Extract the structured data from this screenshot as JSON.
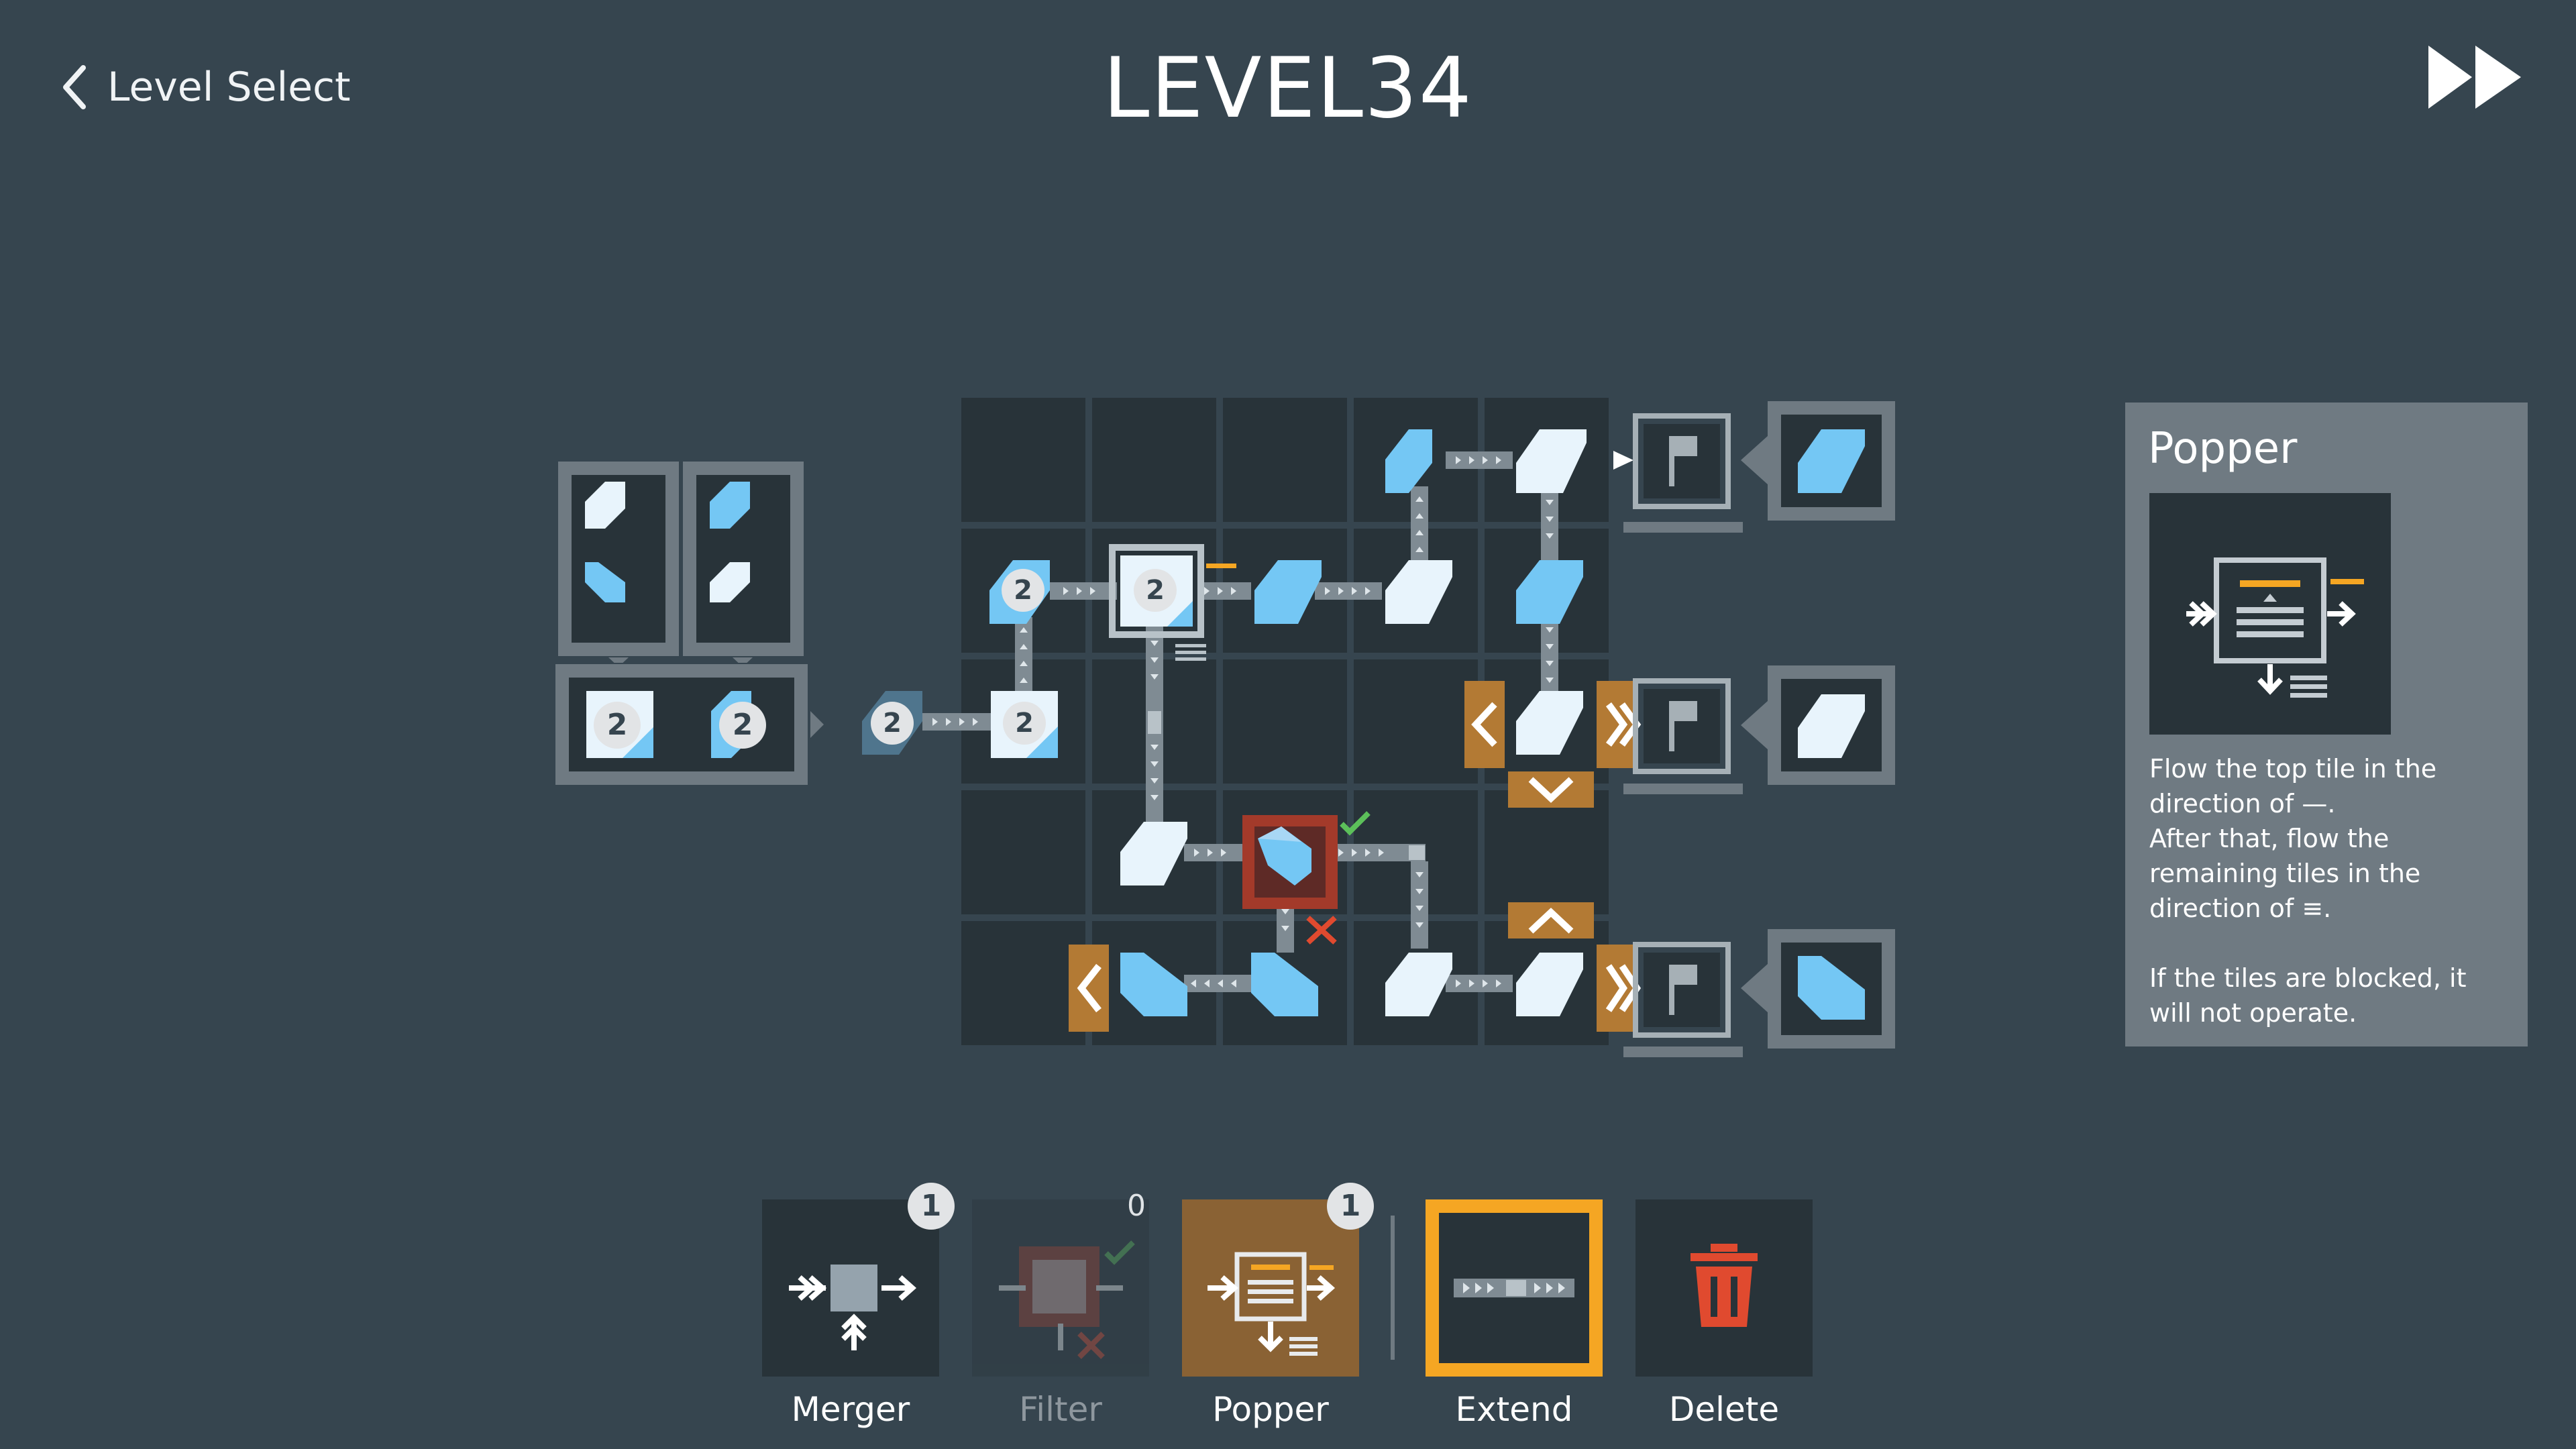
{
  "header": {
    "back_label": "Level Select",
    "title": "LEVEL34"
  },
  "colors": {
    "background": "#36454f",
    "cell": "#283339",
    "tile_blue": "#74c7f4",
    "tile_white": "#e8f4fc",
    "accent_orange": "#f5a623",
    "warn_red": "#e04a2f",
    "check_green": "#5cc05a",
    "directional_orange": "#b37a34"
  },
  "source_tiles": {
    "count_badges": [
      "2",
      "2",
      "2",
      "2",
      "2",
      "2"
    ]
  },
  "info_panel": {
    "title": "Popper",
    "lines": [
      "Flow the top tile in the",
      "direction of —.",
      "After that, flow the",
      "remaining tiles in the",
      "direction of ≡.",
      "",
      "If the tiles are blocked, it",
      "will not operate."
    ]
  },
  "toolbar": {
    "items": [
      {
        "label": "Merger",
        "count": "1",
        "icon": "merger-icon"
      },
      {
        "label": "Filter",
        "count": "0",
        "icon": "filter-icon"
      },
      {
        "label": "Popper",
        "count": "1",
        "icon": "popper-icon"
      },
      {
        "label": "Extend",
        "icon": "conveyor-icon"
      },
      {
        "label": "Delete",
        "icon": "trash-icon"
      }
    ]
  }
}
